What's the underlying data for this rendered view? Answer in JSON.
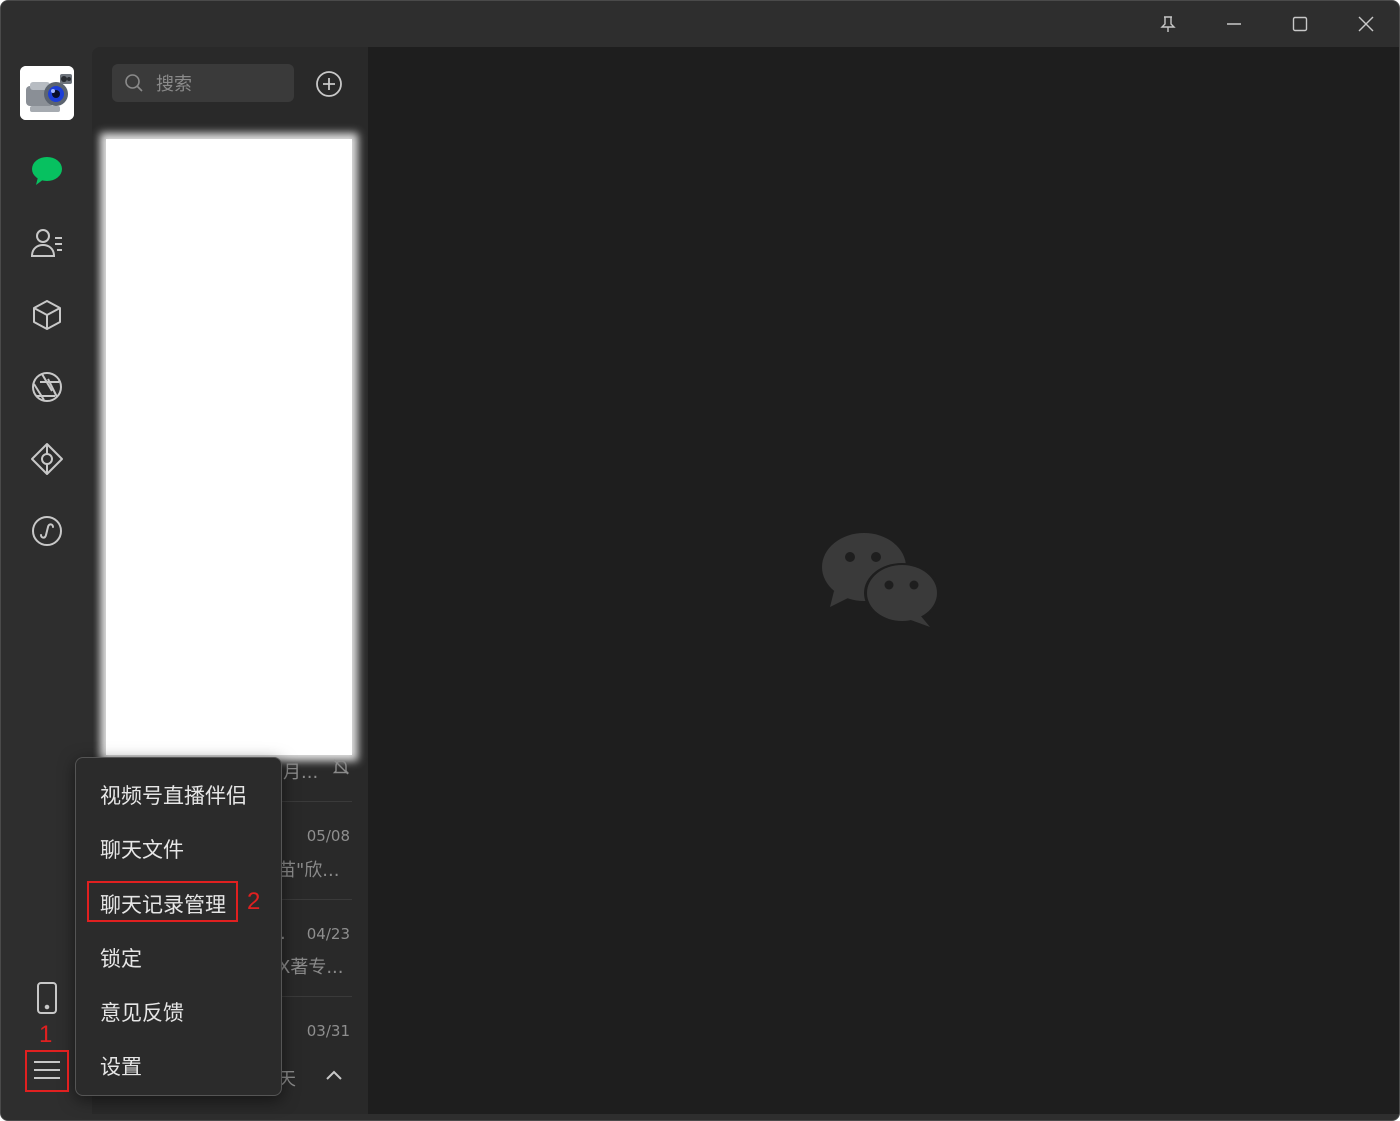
{
  "window": {
    "titlebar_buttons": [
      "pin-icon",
      "minimize-icon",
      "maximize-icon",
      "close-icon"
    ]
  },
  "nav": {
    "items": [
      {
        "name": "chat",
        "icon": "chat-bubble-icon",
        "active": true
      },
      {
        "name": "contacts",
        "icon": "contacts-icon"
      },
      {
        "name": "favorites",
        "icon": "cube-icon"
      },
      {
        "name": "moments",
        "icon": "aperture-icon"
      },
      {
        "name": "channels",
        "icon": "diamond-icon"
      },
      {
        "name": "mini-programs",
        "icon": "miniprogram-icon"
      }
    ],
    "bottom": [
      {
        "name": "phone",
        "icon": "phone-icon"
      },
      {
        "name": "more",
        "icon": "menu-icon"
      }
    ]
  },
  "search": {
    "placeholder": "搜索"
  },
  "chat_list": {
    "partial_rows": [
      {
        "snippet": "i月...",
        "time": ""
      },
      {
        "snippet": "苗\"欣...",
        "time": "05/08"
      },
      {
        "snippet": "X著专...",
        "time": "04/23"
      },
      {
        "snippet": "",
        "time": "03/31"
      }
    ],
    "row2_tail": ".",
    "row4_tail": "天"
  },
  "menu": {
    "items": [
      "视频号直播伴侣",
      "聊天文件",
      "聊天记录管理",
      "锁定",
      "意见反馈",
      "设置"
    ]
  },
  "annotations": {
    "label1": "1",
    "label2": "2"
  },
  "colors": {
    "accent": "#07c160",
    "annotation": "#e02020"
  }
}
